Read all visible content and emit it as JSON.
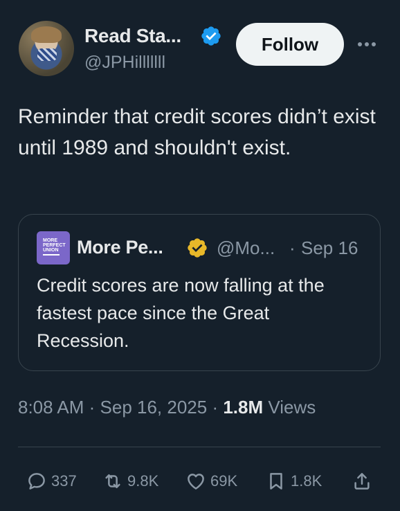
{
  "author": {
    "display_name": "Read Sta...",
    "handle": "@JPHilllllll",
    "verified_color": "#1d9bf0"
  },
  "follow_label": "Follow",
  "tweet": {
    "text": "Reminder that credit scores didn’t exist until 1989 and shouldn't exist."
  },
  "quote": {
    "logo_lines": [
      "MORE",
      "PERFECT",
      "UNION"
    ],
    "logo_color": "#7b67c9",
    "name": "More Pe...",
    "badge_color": "#e8b829",
    "handle": "@Mo...",
    "separator": "·",
    "date": "Sep 16",
    "text": "Credit scores are now falling at the fastest pace since the Great Recession."
  },
  "meta": {
    "time": "8:08 AM",
    "sep1": " · ",
    "date": "Sep 16, 2025",
    "sep2": " · ",
    "views_count": "1.8M",
    "views_label": " Views"
  },
  "actions": {
    "replies": "337",
    "reposts": "9.8K",
    "likes": "69K",
    "bookmarks": "1.8K"
  },
  "icons": [
    "verified-badge-icon",
    "more-icon",
    "reply-icon",
    "repost-icon",
    "like-icon",
    "bookmark-icon",
    "share-icon"
  ]
}
